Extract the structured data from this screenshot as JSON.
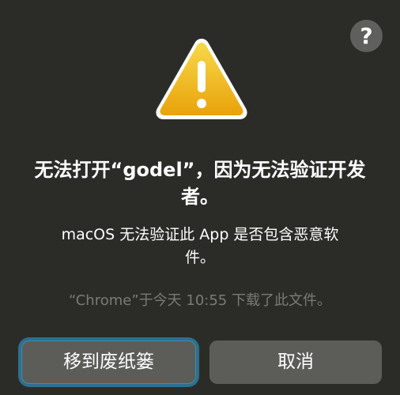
{
  "dialog": {
    "help_label": "?",
    "icon": "warning-triangle-icon",
    "title": "无法打开“godel”，因为无法验证开发者。",
    "message": "macOS 无法验证此 App 是否包含恶意软件。",
    "source": "“Chrome”于今天 10:55 下载了此文件。",
    "buttons": {
      "move_to_trash": "移到废纸篓",
      "cancel": "取消"
    },
    "colors": {
      "background": "#2b2c28",
      "warning_yellow": "#f5c518",
      "focus_ring": "#2e6f8f"
    }
  }
}
